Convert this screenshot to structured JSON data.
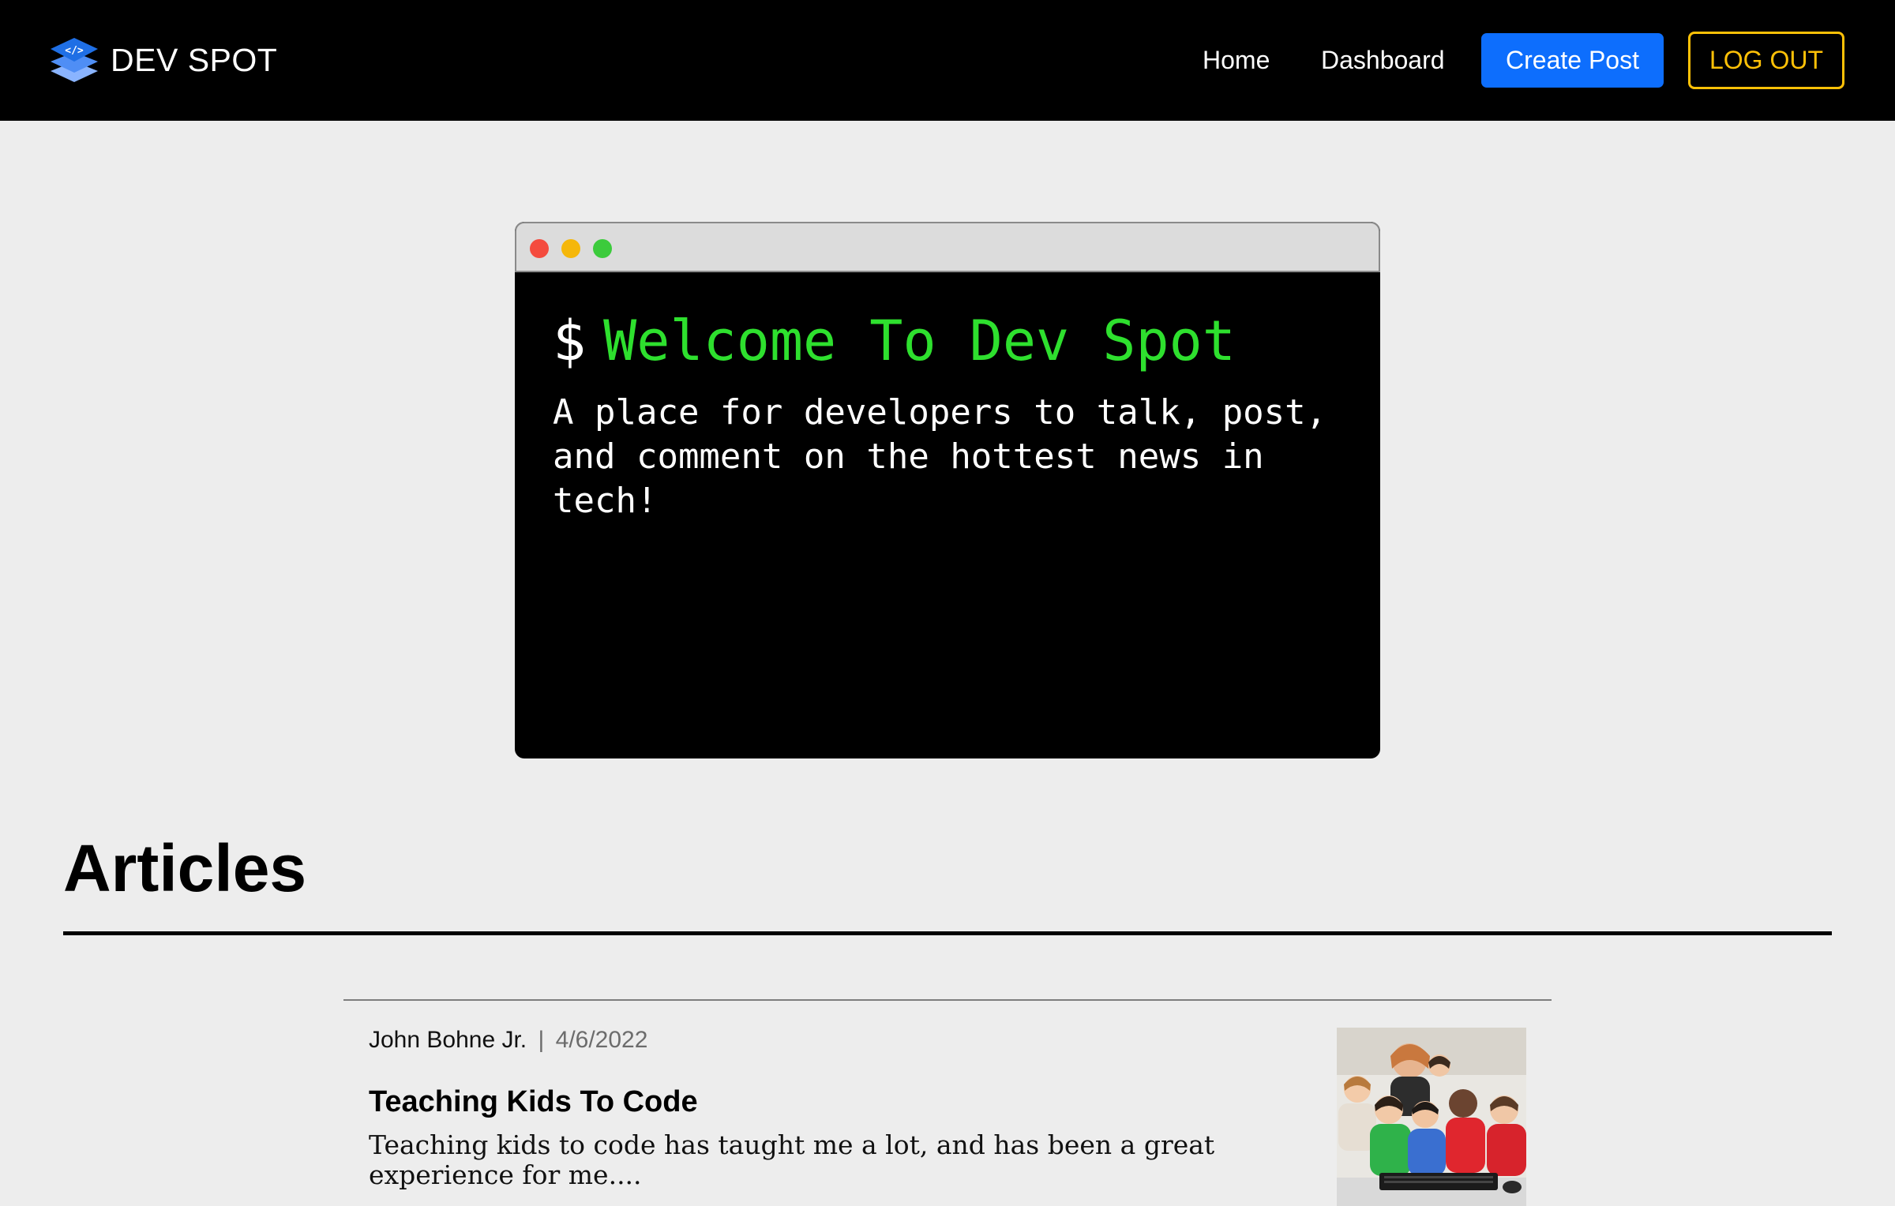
{
  "navbar": {
    "brand_name": "DEV SPOT",
    "links": {
      "home": "Home",
      "dashboard": "Dashboard"
    },
    "create_post_label": "Create Post",
    "logout_label": "LOG OUT",
    "colors": {
      "background": "#000000",
      "create_post": "#0d6efd",
      "logout": "#ffc107"
    }
  },
  "terminal": {
    "prompt": "$",
    "title": "Welcome To Dev Spot",
    "description": "A place for developers to talk, post, and comment on the hottest news in tech!",
    "colors": {
      "title": "#2ee02e",
      "dot_red": "#f44b3e",
      "dot_yellow": "#f5b70a",
      "dot_green": "#3ccb3c"
    }
  },
  "articles": {
    "heading": "Articles",
    "items": [
      {
        "author": "John Bohne Jr.",
        "separator": "|",
        "date": "4/6/2022",
        "title": "Teaching Kids To Code",
        "excerpt": "Teaching kids to code has taught me a lot, and has been a great experience for me....",
        "thumbnail": "kids-at-computer-photo"
      }
    ]
  }
}
